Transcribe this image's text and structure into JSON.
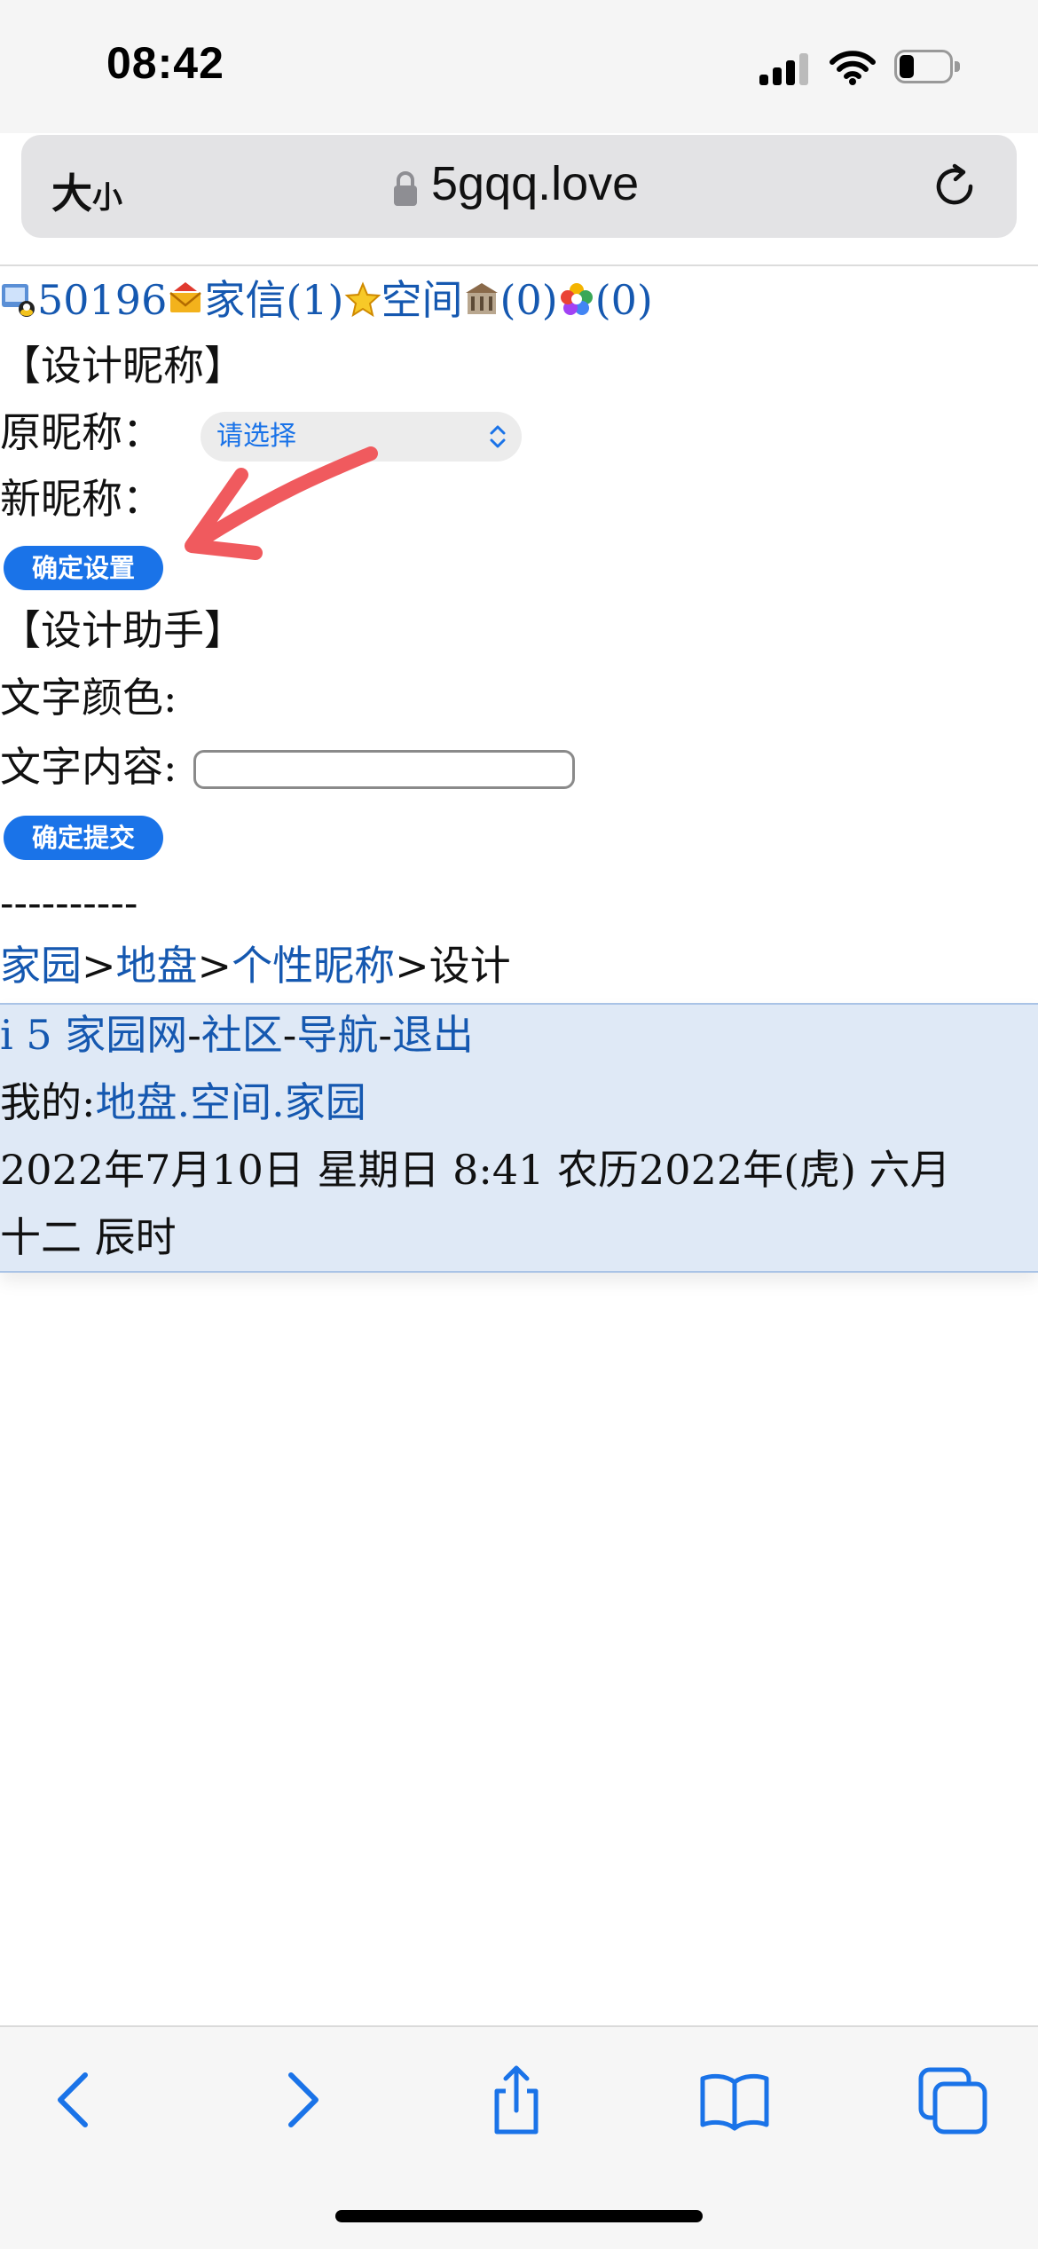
{
  "status": {
    "time": "08:42"
  },
  "browser": {
    "text_size_label": "大",
    "text_size_small": "小",
    "url": "5gqq.love"
  },
  "page": {
    "user_bar": {
      "user_id": "50196",
      "mail_label": "家信",
      "mail_count": "(1)",
      "space_label": "空间",
      "building_count": "(0)",
      "colorful_count": "(0)"
    },
    "nickname_section": {
      "heading": "【设计昵称】",
      "old_label": "原昵称：",
      "new_label": "新昵称：",
      "confirm_button": "确定设置"
    },
    "helper_section": {
      "heading": "【设计助手】",
      "color_label": "文字颜色:",
      "color_select": "请选择",
      "content_label": "文字内容:",
      "submit_button": "确定提交"
    },
    "divider": "----------",
    "breadcrumb": {
      "home": "家园",
      "sep1": ">",
      "land": "地盘",
      "sep2": ">",
      "nickname": "个性昵称",
      "sep3": ">",
      "current": "设计"
    },
    "footer": {
      "site": "i 5 家园网",
      "sep1": "-",
      "community": "社区",
      "sep2": "-",
      "nav": "导航",
      "sep3": "-",
      "logout": "退出",
      "mine_label": "我的:",
      "mine_land": "地盘",
      "dot1": ".",
      "mine_space": "空间",
      "dot2": ".",
      "mine_home": "家园",
      "date_line1": "2022年7月10日  星期日  8:41  农历2022年(虎)  六月",
      "date_line2": "十二  辰时"
    }
  },
  "colors": {
    "link": "#1558b0",
    "button": "#1a73e8",
    "footer_bg": "#dfe9f6",
    "annotation_arrow": "#f05a5e"
  }
}
